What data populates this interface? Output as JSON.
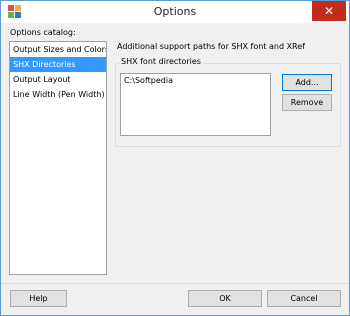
{
  "window": {
    "title": "Options",
    "close_glyph": "✕",
    "app_icon": "grid-app-icon"
  },
  "catalog": {
    "label": "Options catalog:",
    "items": [
      {
        "label": "Output Sizes and Colors",
        "selected": false
      },
      {
        "label": "SHX Directories",
        "selected": true
      },
      {
        "label": "Output Layout",
        "selected": false
      },
      {
        "label": "Line Width (Pen Width)",
        "selected": false
      }
    ]
  },
  "panel": {
    "heading": "Additional support paths for SHX font and XRef",
    "group_caption": "SHX font directories",
    "directories": [
      "C:\\Softpedia"
    ],
    "add_label": "Add...",
    "remove_label": "Remove"
  },
  "footer": {
    "help_label": "Help",
    "ok_label": "OK",
    "cancel_label": "Cancel"
  },
  "colors": {
    "selection": "#3399ff",
    "close_button": "#c42b1c",
    "window_border": "#5e9bd6",
    "focus_border": "#0078d7"
  }
}
